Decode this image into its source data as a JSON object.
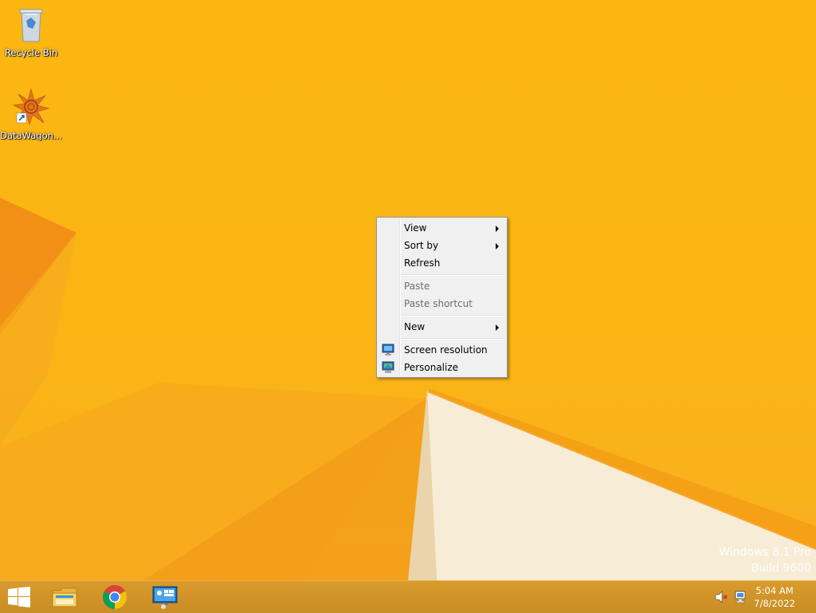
{
  "desktop": {
    "icons": [
      {
        "label": "Recycle Bin",
        "icon": "recycle-bin-icon"
      },
      {
        "label": "DataWagon...",
        "icon": "datawagon-icon"
      }
    ],
    "watermark": {
      "line1": "Windows 8.1 Pro",
      "line2": "Build 9600"
    }
  },
  "context_menu": {
    "items": [
      {
        "label": "View",
        "submenu": true,
        "enabled": true
      },
      {
        "label": "Sort by",
        "submenu": true,
        "enabled": true
      },
      {
        "label": "Refresh",
        "submenu": false,
        "enabled": true
      },
      {
        "label": "Paste",
        "submenu": false,
        "enabled": false
      },
      {
        "label": "Paste shortcut",
        "submenu": false,
        "enabled": false
      },
      {
        "label": "New",
        "submenu": true,
        "enabled": true
      },
      {
        "label": "Screen resolution",
        "submenu": false,
        "enabled": true,
        "icon": "monitor-icon"
      },
      {
        "label": "Personalize",
        "submenu": false,
        "enabled": true,
        "icon": "personalize-icon"
      }
    ]
  },
  "taskbar": {
    "pinned": [
      {
        "name": "file-explorer",
        "icon": "folder-icon"
      },
      {
        "name": "chrome",
        "icon": "chrome-icon"
      },
      {
        "name": "remote-desktop",
        "icon": "remote-desktop-icon"
      }
    ],
    "tray": {
      "volume_icon": "volume-muted-icon",
      "network_icon": "network-icon"
    },
    "clock": {
      "time": "5:04 AM",
      "date": "7/8/2022"
    }
  },
  "colors": {
    "wallpaper": "#fbb612",
    "taskbar": "#d4962a",
    "menu_bg": "#f0f0f0"
  }
}
